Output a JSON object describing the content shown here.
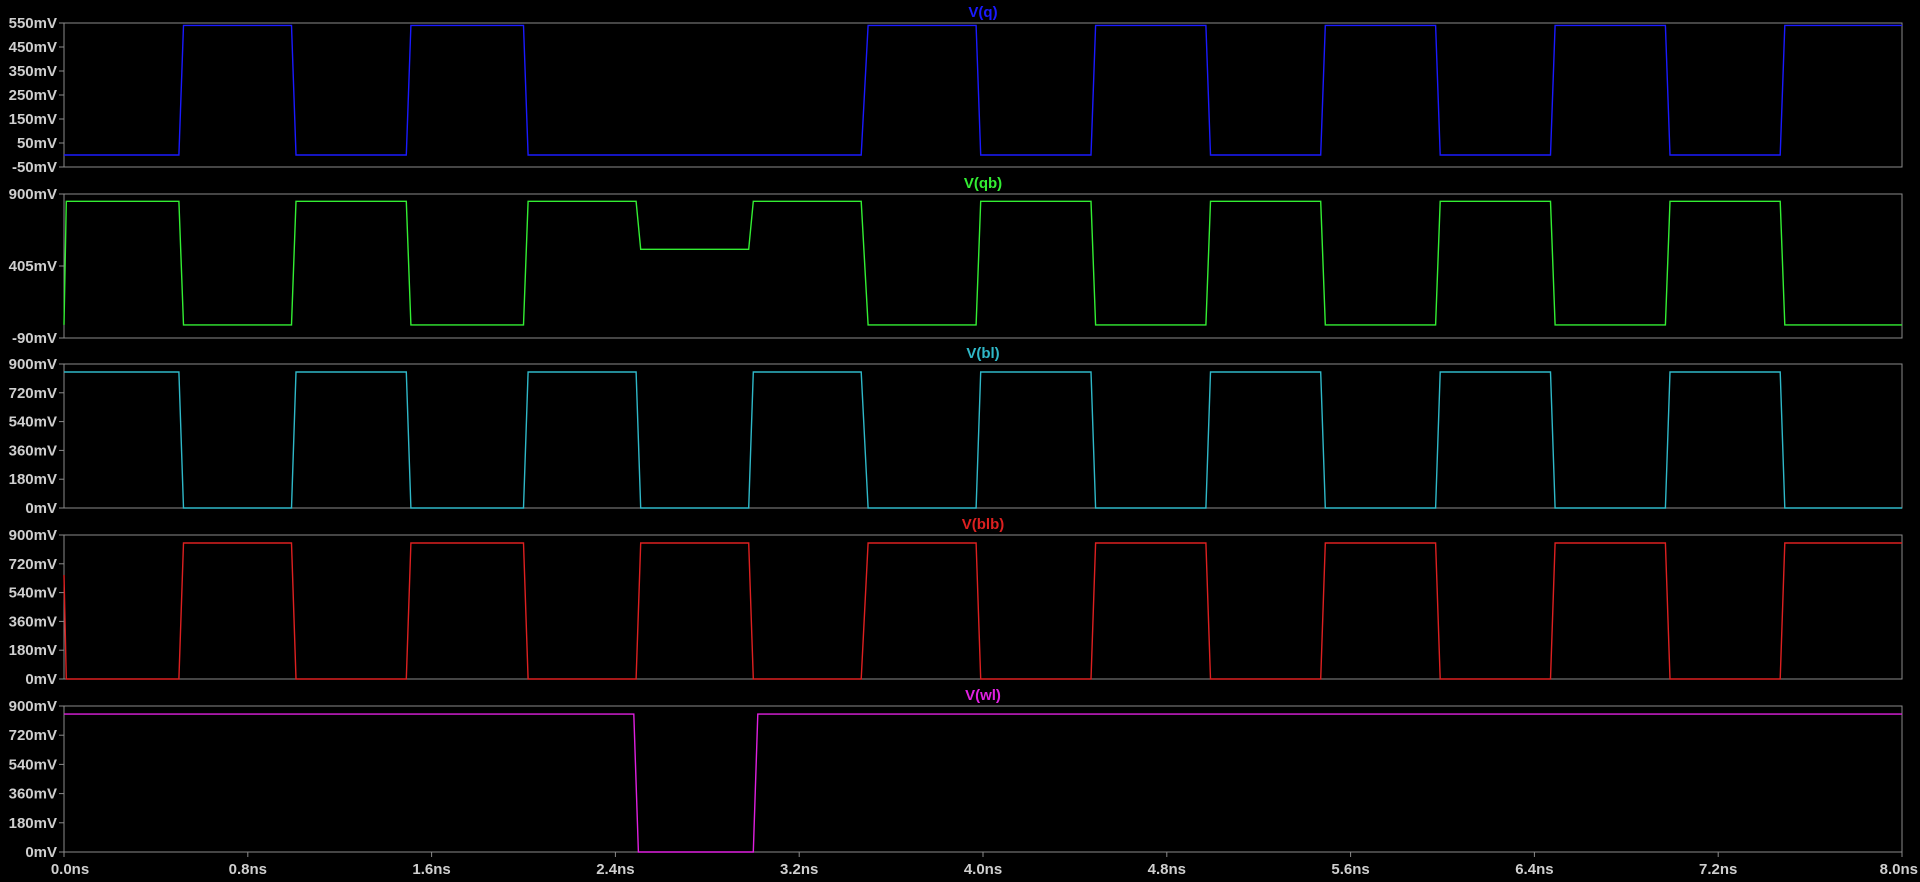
{
  "chart_data": {
    "type": "line",
    "x_unit": "ns",
    "x_range": [
      0,
      8
    ],
    "x_ticks": [
      "0.0ns",
      "0.8ns",
      "1.6ns",
      "2.4ns",
      "3.2ns",
      "4.0ns",
      "4.8ns",
      "5.6ns",
      "6.4ns",
      "7.2ns",
      "8.0ns"
    ],
    "grid": false,
    "panels": [
      {
        "title": "V(q)",
        "color": "#1a1aff",
        "ylim": [
          -0.05,
          0.55
        ],
        "y_ticks": [
          "550mV",
          "450mV",
          "350mV",
          "250mV",
          "150mV",
          "50mV",
          "-50mV"
        ],
        "x": [
          0,
          0.5,
          0.52,
          0.99,
          1.01,
          1.49,
          1.51,
          2.0,
          2.02,
          3.47,
          3.5,
          3.97,
          3.99,
          4.47,
          4.49,
          4.97,
          4.99,
          5.47,
          5.49,
          5.97,
          5.99,
          6.47,
          6.49,
          6.97,
          6.99,
          7.47,
          7.49,
          8.0
        ],
        "y": [
          0,
          0,
          0.54,
          0.54,
          0,
          0,
          0.54,
          0.54,
          0,
          0,
          0.54,
          0.54,
          0,
          0,
          0.54,
          0.54,
          0,
          0,
          0.54,
          0.54,
          0,
          0,
          0.54,
          0.54,
          0,
          0,
          0.54,
          0.54
        ]
      },
      {
        "title": "V(qb)",
        "color": "#33ee33",
        "ylim": [
          -0.09,
          0.9
        ],
        "y_ticks": [
          "900mV",
          "405mV",
          "-90mV"
        ],
        "x": [
          0,
          0.01,
          0.5,
          0.52,
          0.99,
          1.01,
          1.49,
          1.51,
          2.0,
          2.02,
          2.49,
          2.51,
          2.98,
          3.0,
          3.47,
          3.5,
          3.97,
          3.99,
          4.47,
          4.49,
          4.97,
          4.99,
          5.47,
          5.49,
          5.97,
          5.99,
          6.47,
          6.49,
          6.97,
          6.99,
          7.47,
          7.49,
          8.0
        ],
        "y": [
          0,
          0.85,
          0.85,
          0,
          0,
          0.85,
          0.85,
          0,
          0,
          0.85,
          0.85,
          0.52,
          0.52,
          0.85,
          0.85,
          0,
          0,
          0.85,
          0.85,
          0,
          0,
          0.85,
          0.85,
          0,
          0,
          0.85,
          0.85,
          0,
          0,
          0.85,
          0.85,
          0,
          0
        ]
      },
      {
        "title": "V(bl)",
        "color": "#2fb8c8",
        "ylim": [
          0,
          0.9
        ],
        "y_ticks": [
          "900mV",
          "720mV",
          "540mV",
          "360mV",
          "180mV",
          "0mV"
        ],
        "x": [
          0,
          0.5,
          0.52,
          0.99,
          1.01,
          1.49,
          1.51,
          2.0,
          2.02,
          2.49,
          2.51,
          2.98,
          3.0,
          3.47,
          3.5,
          3.97,
          3.99,
          4.47,
          4.49,
          4.97,
          4.99,
          5.47,
          5.49,
          5.97,
          5.99,
          6.47,
          6.49,
          6.97,
          6.99,
          7.47,
          7.49,
          8.0
        ],
        "y": [
          0.85,
          0.85,
          0,
          0,
          0.85,
          0.85,
          0,
          0,
          0.85,
          0.85,
          0,
          0,
          0.85,
          0.85,
          0,
          0,
          0.85,
          0.85,
          0,
          0,
          0.85,
          0.85,
          0,
          0,
          0.85,
          0.85,
          0,
          0,
          0.85,
          0.85,
          0,
          0
        ]
      },
      {
        "title": "V(blb)",
        "color": "#dd2020",
        "ylim": [
          0,
          0.9
        ],
        "y_ticks": [
          "900mV",
          "720mV",
          "540mV",
          "360mV",
          "180mV",
          "0mV"
        ],
        "x": [
          0,
          0.01,
          0.5,
          0.52,
          0.99,
          1.01,
          1.49,
          1.51,
          2.0,
          2.02,
          2.49,
          2.51,
          2.98,
          3.0,
          3.47,
          3.5,
          3.97,
          3.99,
          4.47,
          4.49,
          4.97,
          4.99,
          5.47,
          5.49,
          5.97,
          5.99,
          6.47,
          6.49,
          6.97,
          6.99,
          7.47,
          7.49,
          8.0
        ],
        "y": [
          0.65,
          0,
          0,
          0.85,
          0.85,
          0,
          0,
          0.85,
          0.85,
          0,
          0,
          0.85,
          0.85,
          0,
          0,
          0.85,
          0.85,
          0,
          0,
          0.85,
          0.85,
          0,
          0,
          0.85,
          0.85,
          0,
          0,
          0.85,
          0.85,
          0,
          0,
          0.85,
          0.85
        ]
      },
      {
        "title": "V(wl)",
        "color": "#e020e0",
        "ylim": [
          0,
          0.9
        ],
        "y_ticks": [
          "900mV",
          "720mV",
          "540mV",
          "360mV",
          "180mV",
          "0mV"
        ],
        "x": [
          0,
          2.48,
          2.5,
          3.0,
          3.02,
          8.0
        ],
        "y": [
          0.85,
          0.85,
          0,
          0,
          0.85,
          0.85
        ]
      }
    ]
  }
}
